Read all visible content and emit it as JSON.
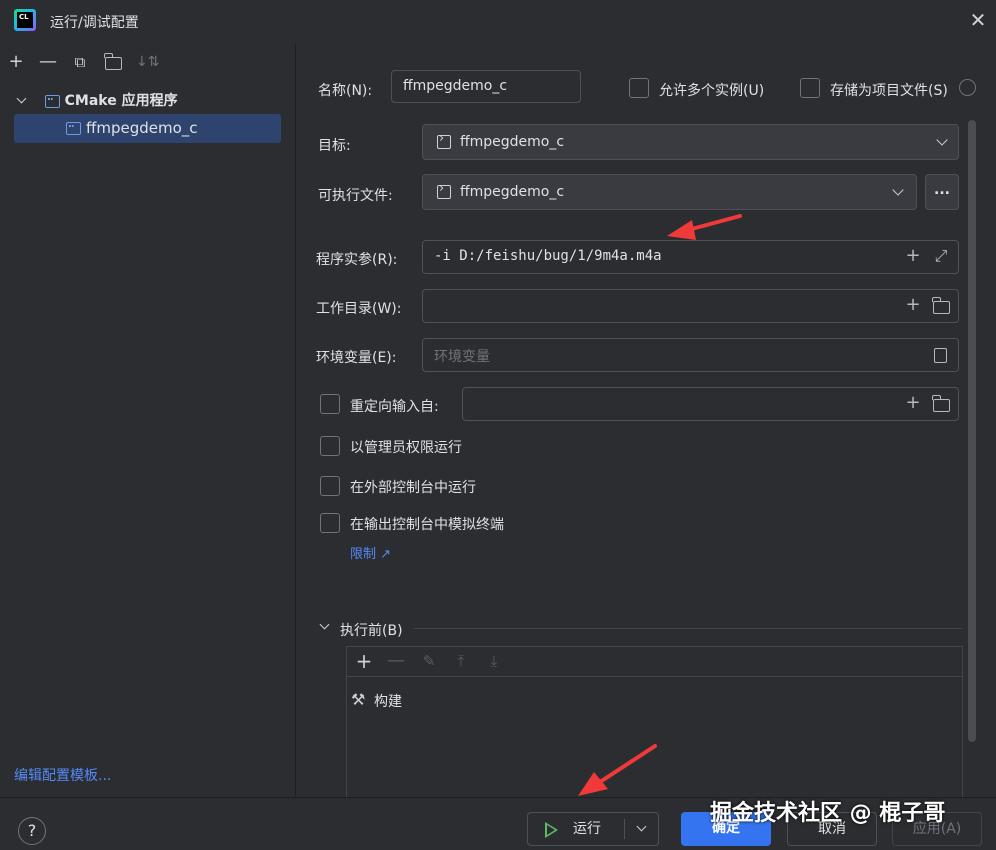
{
  "window": {
    "title": "运行/调试配置",
    "app_icon_text": "CL"
  },
  "toolbar_icons": [
    "add-icon",
    "remove-icon",
    "copy-icon",
    "new-folder-icon",
    "sort-icon"
  ],
  "tree": {
    "group_label": "CMake 应用程序",
    "selected_item": "ffmpegdemo_c",
    "edit_templates_link": "编辑配置模板..."
  },
  "form": {
    "name_label": "名称(N):",
    "name_value": "ffmpegdemo_c",
    "allow_multiple_label": "允许多个实例(U)",
    "store_as_project_file_label": "存储为项目文件(S)",
    "target_label": "目标:",
    "target_value": "ffmpegdemo_c",
    "executable_label": "可执行文件:",
    "executable_value": "ffmpegdemo_c",
    "browse_button": "...",
    "program_args_label": "程序实参(R):",
    "program_args_value": "-i D:/feishu/bug/1/9m4a.m4a",
    "working_dir_label": "工作目录(W):",
    "working_dir_value": "",
    "env_label": "环境变量(E):",
    "env_placeholder": "环境变量",
    "redirect_input_label": "重定向输入自:",
    "run_as_admin_label": "以管理员权限运行",
    "run_in_external_console_label": "在外部控制台中运行",
    "emulate_terminal_label": "在输出控制台中模拟终端",
    "limits_link": "限制 ↗"
  },
  "before_launch": {
    "section_label": "执行前(B)",
    "task": "构建"
  },
  "footer": {
    "help": "?",
    "run_button": "运行",
    "ok_button": "确定",
    "cancel_button": "取消",
    "apply_button": "应用(A)",
    "watermark": "掘金技术社区 @ 棍子哥"
  },
  "colors": {
    "accent": "#3574f0",
    "link": "#548af7",
    "selection": "#2e436e",
    "annotation_arrow": "#f03a3a"
  }
}
